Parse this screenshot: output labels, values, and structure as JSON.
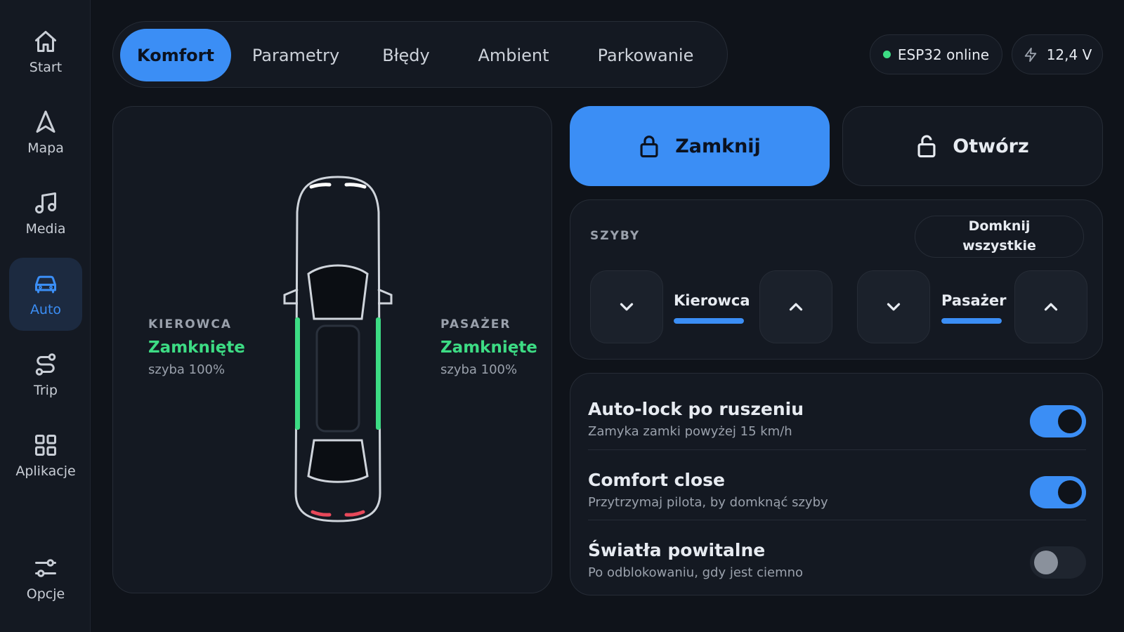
{
  "sidebar": {
    "items": [
      {
        "label": "Start",
        "icon": "home-icon"
      },
      {
        "label": "Mapa",
        "icon": "navigation-icon"
      },
      {
        "label": "Media",
        "icon": "music-icon"
      },
      {
        "label": "Auto",
        "icon": "car-icon",
        "active": true
      },
      {
        "label": "Trip",
        "icon": "route-icon"
      },
      {
        "label": "Aplikacje",
        "icon": "grid-icon"
      },
      {
        "label": "Opcje",
        "icon": "sliders-icon"
      }
    ]
  },
  "tabs": [
    {
      "label": "Komfort",
      "active": true
    },
    {
      "label": "Parametry"
    },
    {
      "label": "Błędy"
    },
    {
      "label": "Ambient"
    },
    {
      "label": "Parkowanie"
    }
  ],
  "status": {
    "connection": "ESP32 online",
    "voltage": "12,4 V"
  },
  "car": {
    "driver": {
      "heading": "KIEROWCA",
      "state": "Zamknięte",
      "window": "szyba 100%"
    },
    "passenger": {
      "heading": "PASAŻER",
      "state": "Zamknięte",
      "window": "szyba 100%"
    }
  },
  "lock": {
    "lock_label": "Zamknij",
    "unlock_label": "Otwórz"
  },
  "windows": {
    "title": "SZYBY",
    "close_all_label": "Domknij wszystkie",
    "driver": {
      "label": "Kierowca",
      "level": 1.0
    },
    "passenger": {
      "label": "Pasażer",
      "level": 1.0
    }
  },
  "settings": [
    {
      "title": "Auto-lock po ruszeniu",
      "subtitle": "Zamyka zamki powyżej 15 km/h",
      "enabled": true
    },
    {
      "title": "Comfort close",
      "subtitle": "Przytrzymaj pilota, by domknąć szyby",
      "enabled": true
    },
    {
      "title": "Światła powitalne",
      "subtitle": "Po odblokowaniu, gdy jest ciemno",
      "enabled": false
    }
  ],
  "colors": {
    "accent": "#3b8ef5",
    "closed_green": "#3ddc84",
    "rear_light_red": "#e8485a",
    "background": "#0f131a",
    "panel": "#141922"
  }
}
